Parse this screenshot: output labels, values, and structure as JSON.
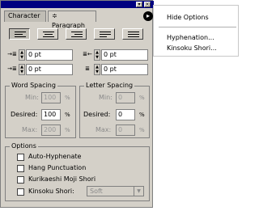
{
  "window": {
    "close_glyph": "×",
    "collapse_glyph": "▾"
  },
  "tabs": [
    {
      "label": "Character"
    },
    {
      "label": "Paragraph",
      "marker": "≑"
    }
  ],
  "menu_button_glyph": "▸",
  "alignment_buttons": [
    "align-left",
    "align-center",
    "align-right",
    "justify-last-left",
    "justify-all"
  ],
  "indents": {
    "left": {
      "value": "0 pt",
      "icon": "→≣"
    },
    "right": {
      "value": "0 pt",
      "icon": "≣←"
    },
    "first_line": {
      "value": "0 pt",
      "icon": "→≣"
    },
    "space_before": {
      "value": "0 pt",
      "icon": "≣"
    }
  },
  "word_spacing": {
    "title": "Word Spacing",
    "min_label": "Min:",
    "min_value": "100",
    "desired_label": "Desired:",
    "desired_value": "100",
    "max_label": "Max:",
    "max_value": "200",
    "unit": "%"
  },
  "letter_spacing": {
    "title": "Letter Spacing",
    "min_label": "Min:",
    "min_value": "0",
    "desired_label": "Desired:",
    "desired_value": "0",
    "max_label": "Max:",
    "max_value": "0",
    "unit": "%"
  },
  "options": {
    "title": "Options",
    "items": [
      {
        "label": "Auto-Hyphenate",
        "checked": false
      },
      {
        "label": "Hang Punctuation",
        "checked": false
      },
      {
        "label": "Kurikaeshi Moji Shori",
        "checked": false
      },
      {
        "label": "Kinsoku Shori:",
        "checked": false
      }
    ],
    "kinsoku_select": "Soft",
    "kinsoku_arrow": "▼"
  },
  "flyout_menu": {
    "items": [
      "Hide Options",
      "Hyphenation...",
      "Kinsoku Shori..."
    ]
  }
}
